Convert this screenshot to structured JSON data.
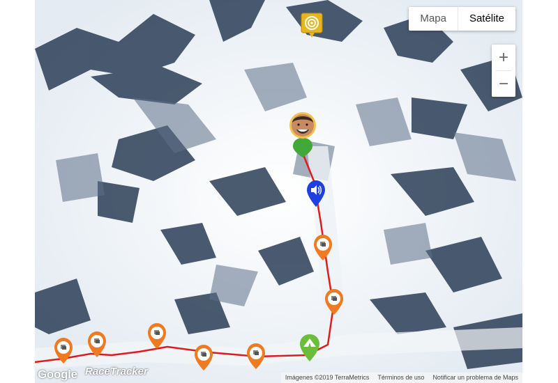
{
  "map_type": {
    "map_label": "Mapa",
    "satellite_label": "Satélite",
    "selected": "Satélite"
  },
  "zoom": {
    "in_label": "+",
    "out_label": "−"
  },
  "attribution": {
    "imagery": "Imágenes ©2019 TerraMetrics",
    "terms": "Términos de uso",
    "report": "Notificar un problema de Maps"
  },
  "logos": {
    "google": "Google",
    "racetracker": "RaceTracker"
  },
  "route_color": "#e01b1b",
  "markers": {
    "summit_icon": "target-icon",
    "checkpoint_color": "#ee7a21",
    "audio_color": "#1f3fe0",
    "camp_color": "#6cbd3a",
    "athlete_pin_color": "#43a83a"
  }
}
